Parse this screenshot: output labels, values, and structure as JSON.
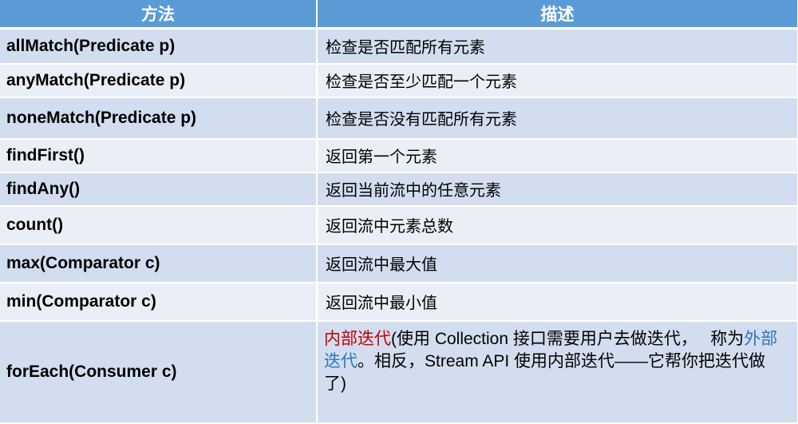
{
  "header": {
    "method": "方法",
    "description": "描述"
  },
  "rows": [
    {
      "method": "allMatch(Predicate p)",
      "description": "检查是否匹配所有元素"
    },
    {
      "method": "anyMatch(Predicate p)",
      "description": "检查是否至少匹配一个元素"
    },
    {
      "method": "noneMatch(Predicate p)",
      "description": "检查是否没有匹配所有元素"
    },
    {
      "method": "findFirst()",
      "description": "返回第一个元素"
    },
    {
      "method": "findAny()",
      "description": "返回当前流中的任意元素"
    },
    {
      "method": "count()",
      "description": "返回流中元素总数"
    },
    {
      "method": "max(Comparator c)",
      "description": "返回流中最大值"
    },
    {
      "method": "min(Comparator c)",
      "description": "返回流中最小值"
    }
  ],
  "foreach": {
    "method": "forEach(Consumer c)",
    "internal_iteration": "内部迭代",
    "text_a": "(使用 Collection 接口需要用户去做迭代，　 称为",
    "external_iteration": "外部迭代",
    "text_b": "。相反，Stream API 使用内部迭代——它帮你把迭代做了)",
    "colors": {
      "internal": "#c00000",
      "external": "#2e74b5"
    }
  }
}
